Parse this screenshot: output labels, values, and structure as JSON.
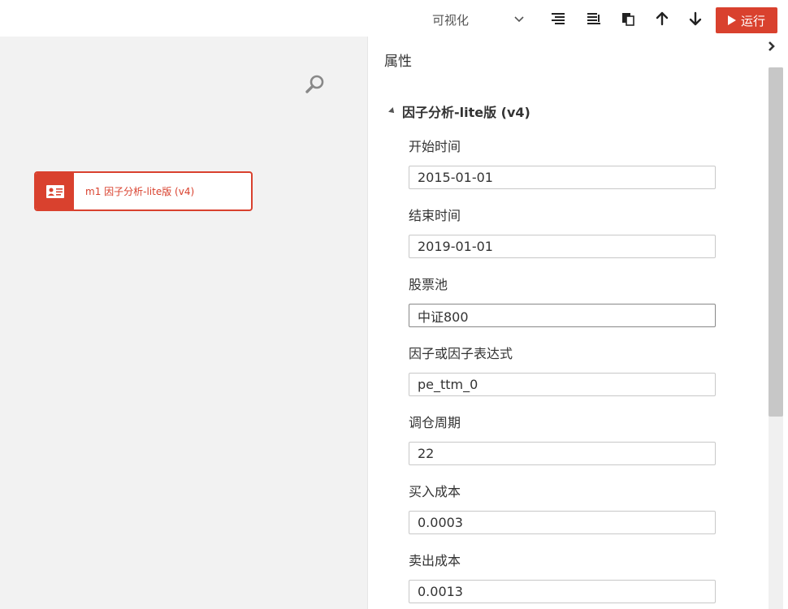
{
  "toolbar": {
    "view_select": "可视化",
    "run_label": "运行",
    "icons": [
      "align-top-icon",
      "align-bottom-icon",
      "paste-icon",
      "arrow-up-icon",
      "arrow-down-icon"
    ]
  },
  "canvas": {
    "node": {
      "label": "m1 因子分析-lite版 (v4)",
      "icon": "id-card-icon",
      "color": "#d9412e"
    }
  },
  "panel": {
    "title": "属性",
    "section_title": "因子分析-lite版 (v4)",
    "fields": [
      {
        "label": "开始时间",
        "value": "2015-01-01"
      },
      {
        "label": "结束时间",
        "value": "2019-01-01"
      },
      {
        "label": "股票池",
        "value": "中证800"
      },
      {
        "label": "因子或因子表达式",
        "value": "pe_ttm_0"
      },
      {
        "label": "调仓周期",
        "value": "22"
      },
      {
        "label": "买入成本",
        "value": "0.0003"
      },
      {
        "label": "卖出成本",
        "value": "0.0013"
      }
    ]
  },
  "colors": {
    "accent": "#d9412e",
    "canvas_bg": "#f2f2f2"
  }
}
